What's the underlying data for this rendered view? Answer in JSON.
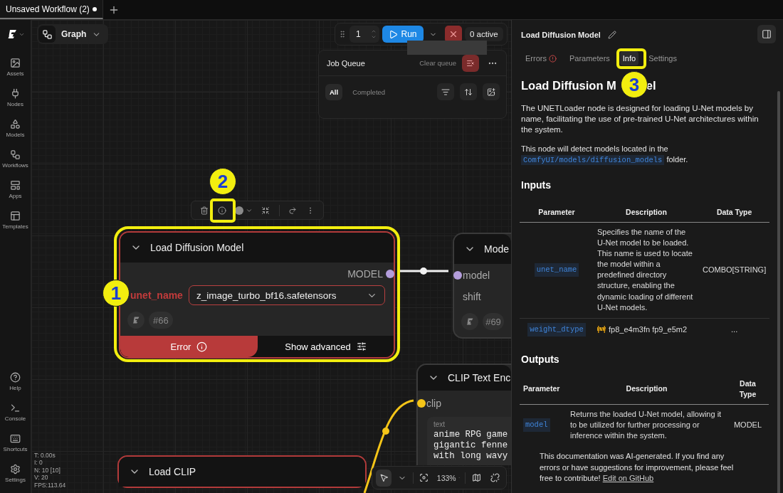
{
  "tabs": [
    {
      "label": "Unsaved Workflow (2)",
      "selected": true,
      "unsaved": true
    }
  ],
  "sidebar": {
    "top": [
      {
        "label": "Assets"
      },
      {
        "label": "Nodes"
      },
      {
        "label": "Models"
      },
      {
        "label": "Workflows"
      },
      {
        "label": "Apps"
      },
      {
        "label": "Templates"
      }
    ],
    "bottom": [
      {
        "label": "Help"
      },
      {
        "label": "Console"
      },
      {
        "label": "Shortcuts"
      },
      {
        "label": "Settings"
      }
    ]
  },
  "canvas": {
    "graph_button": "Graph",
    "run_bar": {
      "count": "1",
      "run": "Run",
      "active": "0 active"
    },
    "job_queue": {
      "title": "Job Queue",
      "clear": "Clear queue",
      "filters": [
        {
          "label": "All",
          "selected": true
        },
        {
          "label": "Completed",
          "selected": false
        }
      ]
    },
    "nodes": [
      {
        "title": "Load Diffusion Model",
        "error": true,
        "outputs": [
          {
            "label": "MODEL",
            "color": "#b39ddb"
          }
        ],
        "widgets": [
          {
            "label": "unet_name",
            "value": "z_image_turbo_bf16.safetensors",
            "error": true
          }
        ],
        "id": "#66",
        "footer": {
          "error": "Error",
          "advanced": "Show advanced"
        }
      },
      {
        "title": "Mode",
        "error": false,
        "inputs": [
          {
            "label": "model",
            "color": "#b39ddb"
          },
          {
            "label": "shift"
          }
        ],
        "id": "#69"
      },
      {
        "title": "CLIP Text Enc",
        "error": false,
        "inputs": [
          {
            "label": "clip",
            "color": "#f5c518"
          }
        ],
        "textbox": {
          "label": "text",
          "lines": [
            "anime RPG game",
            "gigantic fenne",
            "with long wavy"
          ]
        }
      },
      {
        "title": "Load CLIP",
        "error": true
      }
    ],
    "stats": [
      "T: 0.00s",
      "I: 0",
      "N: 10 [10]",
      "V: 20",
      "FPS:113.64"
    ],
    "zoom": "133%"
  },
  "panel": {
    "title": "Load Diffusion Model",
    "tabs": [
      {
        "label": "Errors",
        "selected": false,
        "error": true
      },
      {
        "label": "Parameters",
        "selected": false,
        "error": false
      },
      {
        "label": "Info",
        "selected": true,
        "error": false
      },
      {
        "label": "Settings",
        "selected": false,
        "error": false
      }
    ],
    "heading": [
      "Load Diffusion M",
      "el"
    ],
    "intro": "The UNETLoader node is designed for loading U-Net models by name, facilitating the use of pre-trained U-Net architectures within the system.",
    "detect": {
      "before": "This node will detect models located in the",
      "path": "ComfyUI/models/diffusion_models",
      "after": "folder."
    },
    "inputs": {
      "heading": "Inputs",
      "columns": [
        "Parameter",
        "Description",
        "Data Type"
      ],
      "rows": [
        {
          "param": "unet_name",
          "description": "Specifies the name of the U-Net model to be loaded. This name is used to locate the model within a predefined directory structure, enabling the dynamic loading of different U-Net models.",
          "type": "COMBO[STRING]"
        },
        {
          "param": "weight_dtype",
          "description": "fp8_e4m3fn fp9_e5m2",
          "type": "...",
          "wip": true
        }
      ]
    },
    "outputs": {
      "heading": "Outputs",
      "columns": [
        "Parameter",
        "Description",
        "Data Type"
      ],
      "rows": [
        {
          "param": "model",
          "description": "Returns the loaded U-Net model, allowing it to be utilized for further processing or inference within the system.",
          "type": "MODEL"
        }
      ]
    },
    "note": "This documentation was AI-generated. If you find any errors or have suggestions for improvement, please feel free to contribute!",
    "note_link": "Edit on GitHub"
  },
  "annotations": [
    {
      "label": "1"
    },
    {
      "label": "2"
    },
    {
      "label": "3"
    }
  ]
}
